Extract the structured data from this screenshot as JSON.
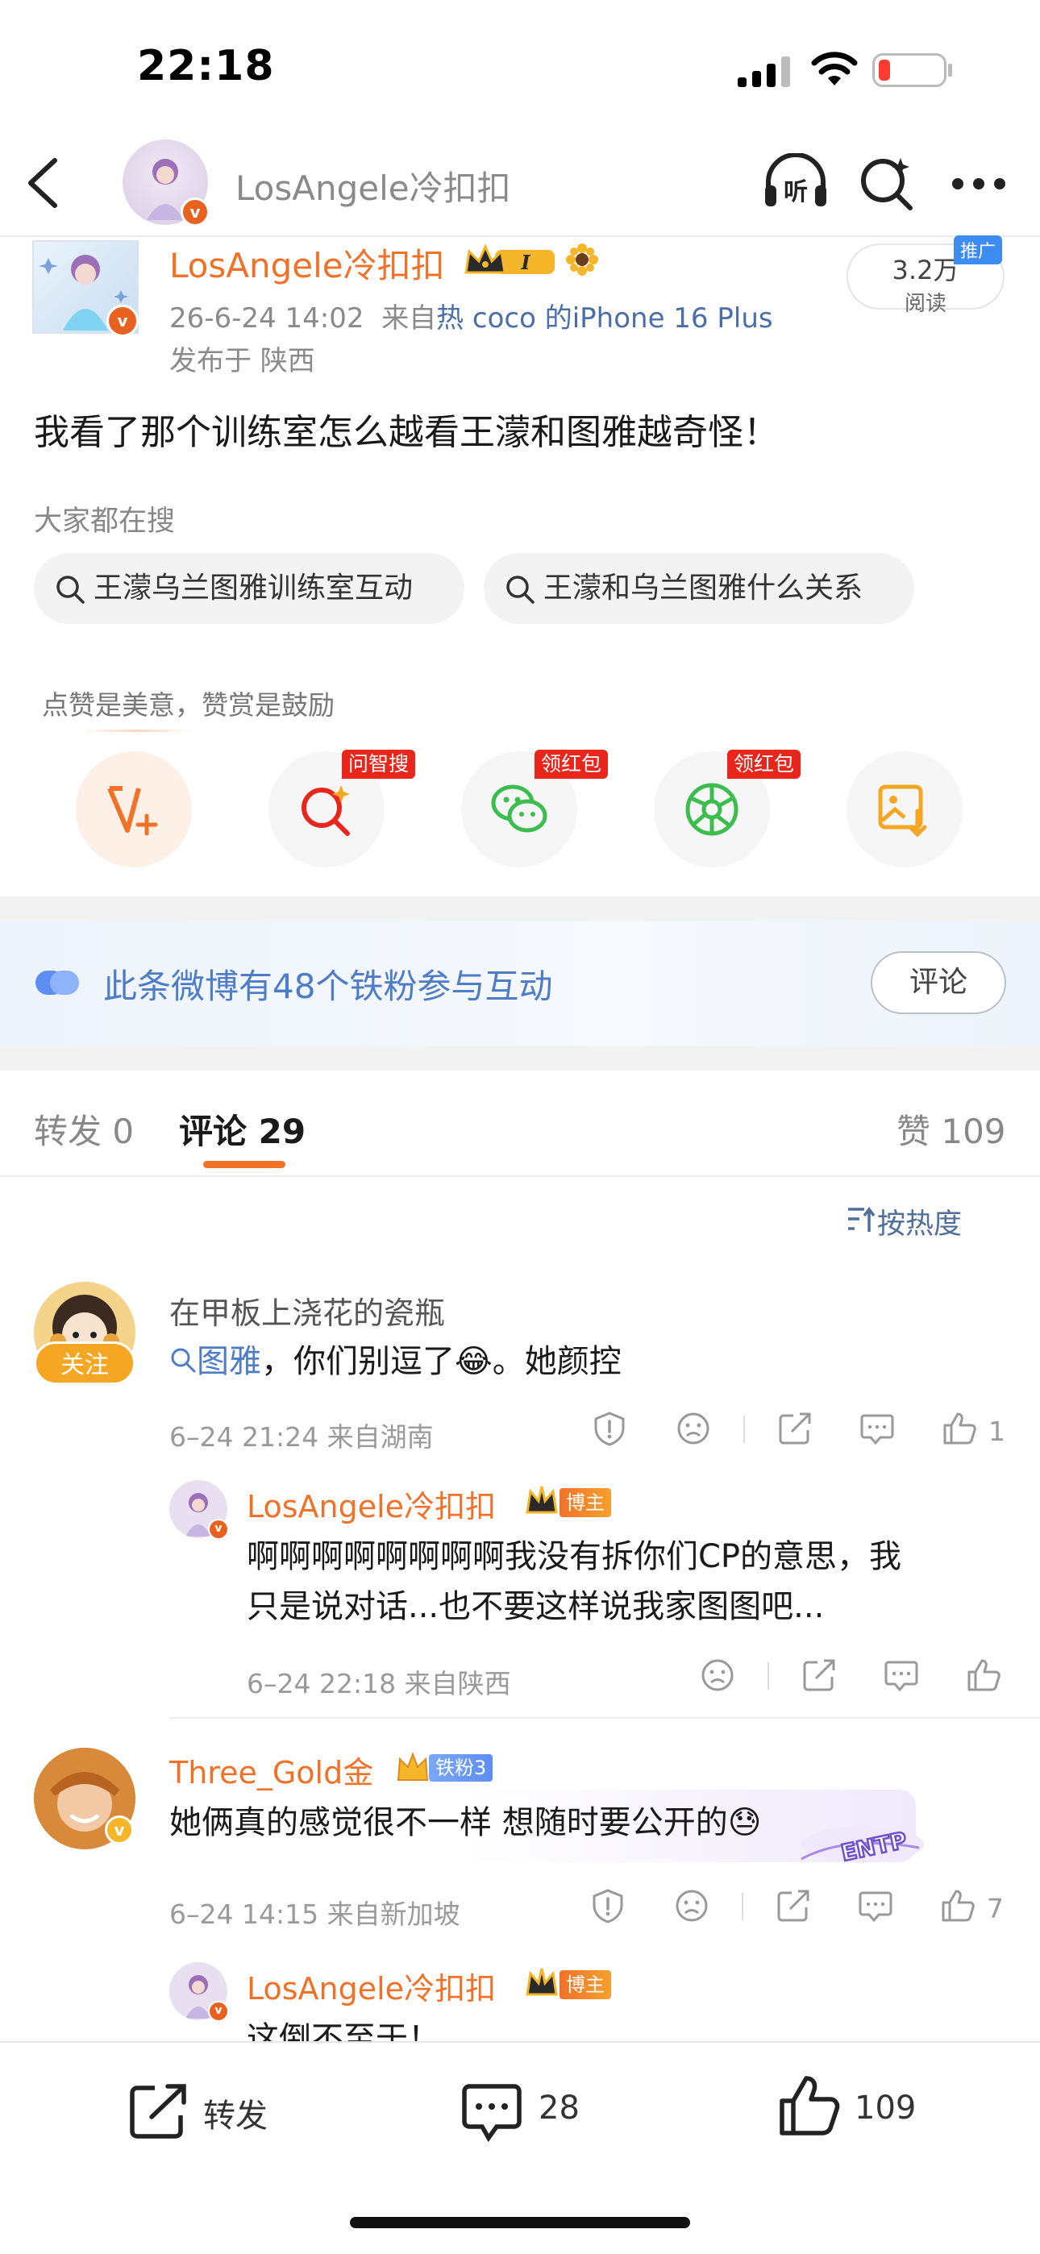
{
  "status_bar": {
    "time": "22:18"
  },
  "nav": {
    "title": "LosAngele冷扣扣"
  },
  "post": {
    "username": "LosAngele冷扣扣",
    "level_badge": "I",
    "date": "26-6-24 14:02",
    "source_prefix": "来自",
    "source": "热 coco 的iPhone 16 Plus",
    "location": "发布于 陕西",
    "reads_value": "3.2万",
    "reads_label": "阅读",
    "promo_tag": "推广",
    "text": "我看了那个训练室怎么越看王濛和图雅越奇怪！"
  },
  "hot_search": {
    "title": "大家都在搜",
    "chips": [
      "王濛乌兰图雅训练室互动",
      "王濛和乌兰图雅什么关系"
    ]
  },
  "reward": {
    "title": "点赞是美意，赞赏是鼓励",
    "tags": [
      "问智搜",
      "领红包",
      "领红包"
    ]
  },
  "fans_banner": {
    "text": "此条微博有48个铁粉参与互动",
    "button": "评论"
  },
  "tabs": {
    "repost": "转发 0",
    "comments": "评论 29",
    "likes": "赞 109"
  },
  "sort": {
    "label": "按热度"
  },
  "comments": [
    {
      "username": "在甲板上浇花的瓷瓶",
      "follow_label": "关注",
      "topic": "图雅",
      "text_after": "，你们别逗了",
      "text_tail": "。她颜控",
      "emoji": "😂",
      "meta": "6–24 21:24  来自湖南",
      "likes": "1",
      "reply": {
        "username": "LosAngele冷扣扣",
        "badge": "博主",
        "text_line1": "啊啊啊啊啊啊啊啊我没有拆你们CP的意思，我",
        "text_line2": "只是说对话...也不要这样说我家图图吧...",
        "meta": "6–24 22:18  来自陕西"
      }
    },
    {
      "username": "Three_Gold金",
      "badge": "铁粉3",
      "text": "她俩真的感觉很不一样 想随时要公开的",
      "emoji": "😓",
      "sticker": "ENTP",
      "meta": "6–24 14:15  来自新加坡",
      "likes": "7",
      "reply": {
        "username": "LosAngele冷扣扣",
        "badge": "博主",
        "text_partial": "这倒不至于！"
      }
    }
  ],
  "bottom_bar": {
    "repost": "转发",
    "comments": "28",
    "likes": "109"
  },
  "colors": {
    "accent": "#f07228",
    "link": "#4e7cc6",
    "red_tag": "#e8261c"
  }
}
